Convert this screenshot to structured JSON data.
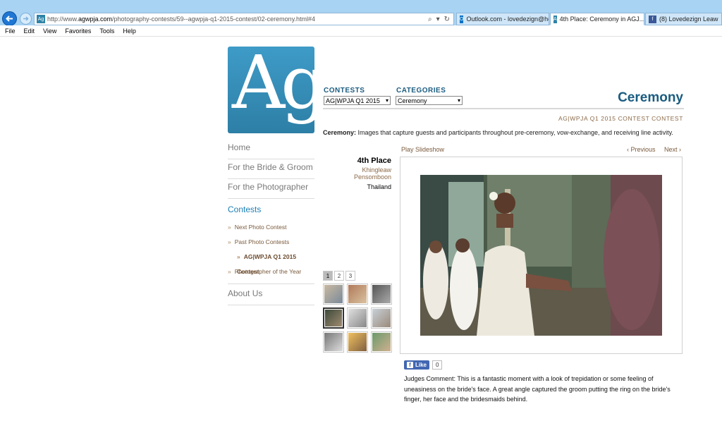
{
  "browser": {
    "url_prefix": "http://www.",
    "url_domain": "agwpja.com",
    "url_path": "/photography-contests/59--agwpja-q1-2015-contest/02-ceremony.html#4",
    "tabs": [
      {
        "label": "Outlook.com - lovedezign@ho..."
      },
      {
        "label": "4th Place: Ceremony in AGJ..."
      },
      {
        "label": "(8) Lovedezign Leaw"
      }
    ],
    "menu": [
      "File",
      "Edit",
      "View",
      "Favorites",
      "Tools",
      "Help"
    ]
  },
  "logo": {
    "text": "Ag",
    "color": "#2f86b0"
  },
  "sidenav": {
    "home": "Home",
    "bride_groom": "For the Bride & Groom",
    "photographer": "For the Photographer",
    "contests": "Contests",
    "next_contest": "Next Photo Contest",
    "past_contests": "Past Photo Contests",
    "current_contest": "AG|WPJA Q1 2015 Contest",
    "poy": "Photographer of the Year",
    "about": "About Us"
  },
  "filters": {
    "contests_label": "CONTESTS",
    "contests_value": "AG|WPJA Q1 2015",
    "categories_label": "CATEGORIES",
    "categories_value": "Ceremony"
  },
  "page": {
    "title": "Ceremony",
    "subtitle": "AG|WPJA Q1 2015 CONTEST CONTEST",
    "category_name": "Ceremony:",
    "category_desc": " Images that capture guests and participants throughout pre-ceremony, vow-exchange, and receiving line activity."
  },
  "controls": {
    "play": "Play Slideshow",
    "previous": "‹ Previous",
    "next": "Next ›"
  },
  "entry": {
    "place": "4th Place",
    "photographer": "Khingleaw Pensomboon",
    "country": "Thailand"
  },
  "pager": [
    "1",
    "2",
    "3"
  ],
  "like": {
    "label": "Like",
    "count": "0"
  },
  "comment": "Judges Comment: This is a fantastic moment with a look of trepidation or some feeling of uneasiness on the bride's face. A great angle captured the groom putting the ring on the bride's finger, her face and the bridesmaids behind."
}
